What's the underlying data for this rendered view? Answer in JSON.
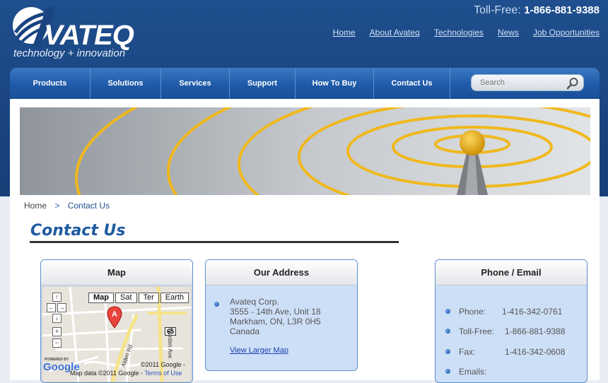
{
  "header": {
    "logo_text": "VATEQ",
    "logo_tagline": "technology + innovation",
    "tollfree_label": "Toll-Free:",
    "tollfree_number": "1-866-881-9388",
    "links": [
      "Home",
      "About Avateq",
      "Technologies",
      "News",
      "Job Opportunities"
    ]
  },
  "nav": {
    "items": [
      "Products",
      "Solutions",
      "Services",
      "Support",
      "How To Buy",
      "Contact Us"
    ],
    "search_placeholder": "Search"
  },
  "breadcrumb": {
    "home": "Home",
    "separator": ">",
    "current": "Contact Us"
  },
  "page_title": "Contact Us",
  "map_panel": {
    "title": "Map",
    "buttons": [
      "Map",
      "Sat",
      "Ter",
      "Earth"
    ],
    "marker_label": "A",
    "copyright": "©2011 Google -",
    "data_credit": "Map data ©2011 Google -",
    "terms": "Terms of Use",
    "powered_by": "POWERED BY",
    "google_logo": "Google",
    "highway": "65",
    "road_1": "Alden Rd",
    "road_2": "Warden Ave"
  },
  "address_panel": {
    "title": "Our Address",
    "lines": [
      "Avateq Corp.",
      "3555 - 14th Ave, Unit 18",
      "Markham, ON, L3R 0H5",
      "Canada"
    ],
    "link": "View Larger Map"
  },
  "phone_panel": {
    "title": "Phone / Email",
    "rows": [
      {
        "label": "Phone:",
        "value": "1-416-342-0761"
      },
      {
        "label": "Toll-Free:",
        "value": "1-866-881-9388"
      },
      {
        "label": "Fax:",
        "value": "1-416-342-0608"
      },
      {
        "label": "Emails:",
        "value": ""
      }
    ]
  },
  "colors": {
    "header_blue": "#1a4480",
    "nav_blue": "#1f5aa8",
    "title_blue": "#1f5aa0",
    "panel_fill": "#cddff7",
    "ring_gold": "#f0b81c"
  }
}
